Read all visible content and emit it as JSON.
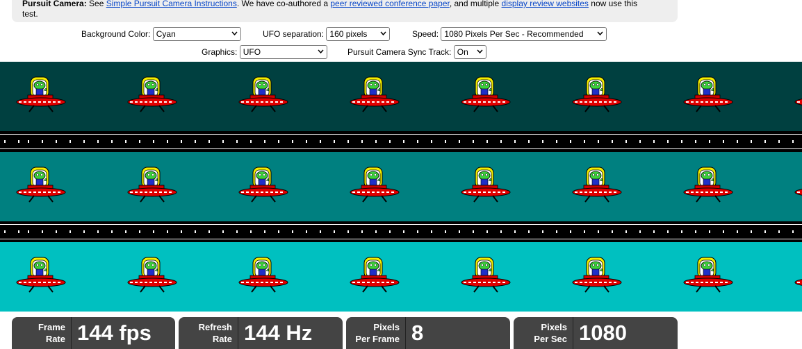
{
  "info": {
    "heading": "Pursuit Camera:",
    "text1": "See",
    "link1": "Simple Pursuit Camera Instructions",
    "text2": ". We have co-authored a",
    "link2": "peer reviewed conference paper",
    "text3": ", and multiple",
    "link3": "display review websites",
    "text4": "now use this",
    "text5": "test."
  },
  "controls": {
    "background": {
      "label": "Background Color:",
      "value": "Cyan"
    },
    "separation": {
      "label": "UFO separation:",
      "value": "160 pixels"
    },
    "speed": {
      "label": "Speed:",
      "value": "1080 Pixels Per Sec - Recommended"
    },
    "graphics": {
      "label": "Graphics:",
      "value": "UFO"
    },
    "sync": {
      "label": "Pursuit Camera Sync Track:",
      "value": "On"
    }
  },
  "bands": [
    {
      "color": "#004040"
    },
    {
      "color": "#008080"
    },
    {
      "color": "#00c0c0"
    }
  ],
  "ufo_count": 7,
  "stats": [
    {
      "key1": "Frame",
      "key2": "Rate",
      "value": "144 fps"
    },
    {
      "key1": "Refresh",
      "key2": "Rate",
      "value": "144 Hz"
    },
    {
      "key1": "Pixels",
      "key2": "Per Frame",
      "value": "8"
    },
    {
      "key1": "Pixels",
      "key2": "Per Sec",
      "value": "1080"
    }
  ]
}
